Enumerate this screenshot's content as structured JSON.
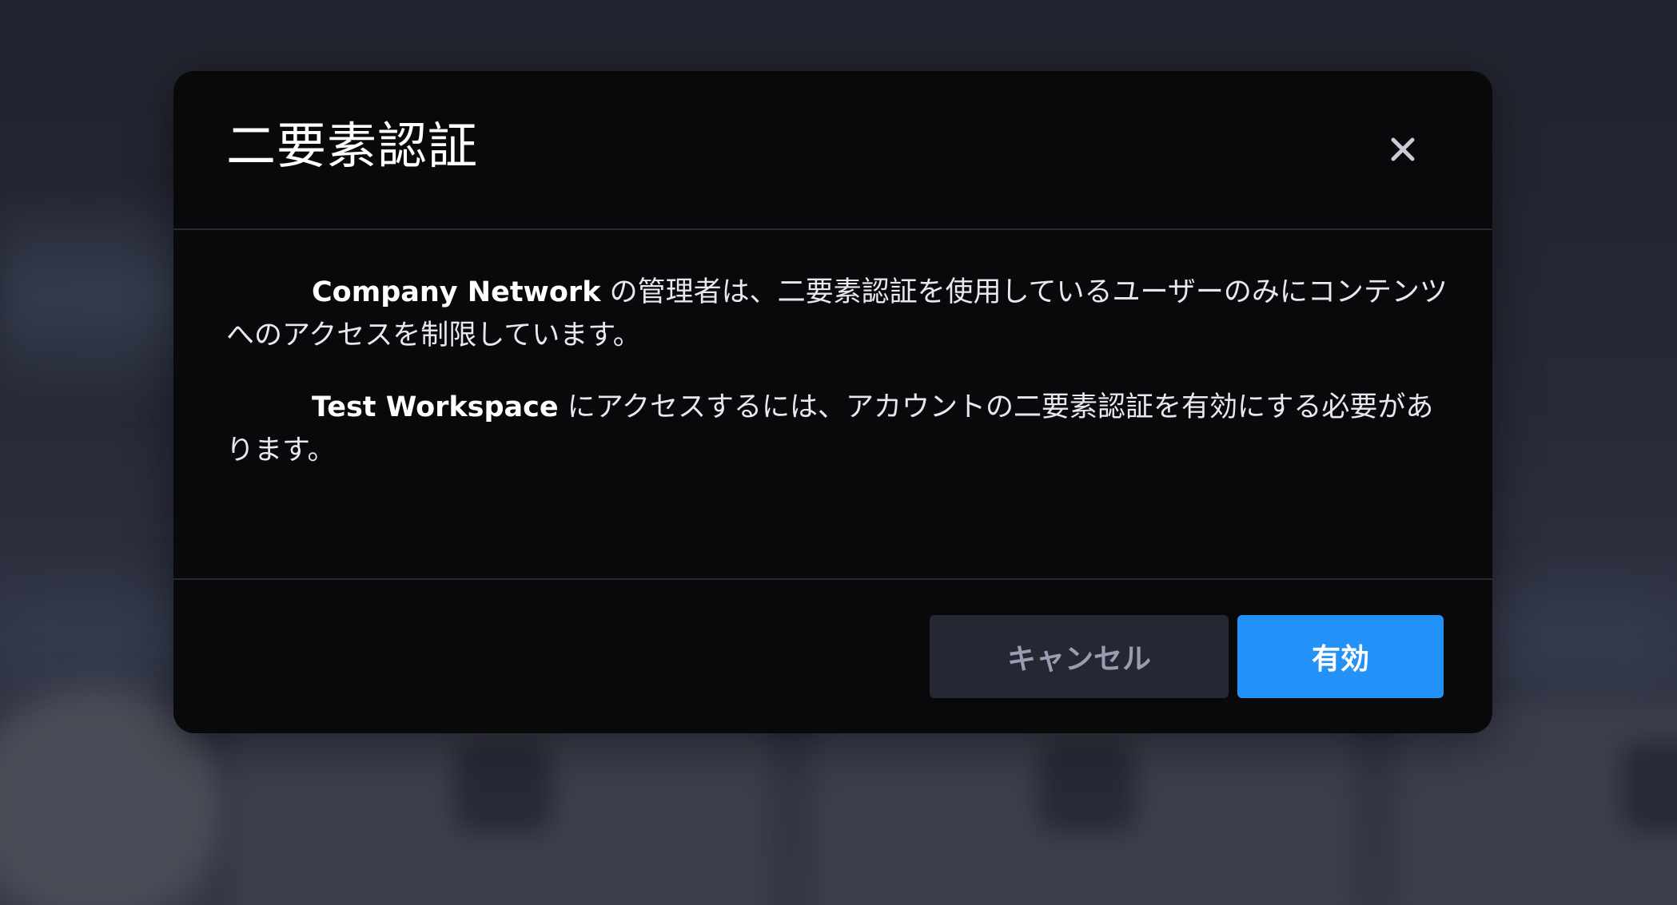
{
  "dialog": {
    "title": "二要素認証",
    "close_icon": "close-icon",
    "paragraphs": [
      {
        "strong": "Company Network",
        "text": " の管理者は、二要素認証を使用しているユーザーのみにコンテンツへのアクセスを制限しています。"
      },
      {
        "strong": "Test Workspace",
        "text": " にアクセスするには、アカウントの二要素認証を有効にする必要があります。"
      }
    ],
    "buttons": {
      "cancel_label": "キャンセル",
      "enable_label": "有効"
    }
  },
  "colors": {
    "modal_background": "#09090c",
    "backdrop": "#22242f",
    "primary_button": "#2392f8",
    "secondary_button": "#252733",
    "secondary_button_text": "#9a9db2",
    "divider": "#262935"
  }
}
